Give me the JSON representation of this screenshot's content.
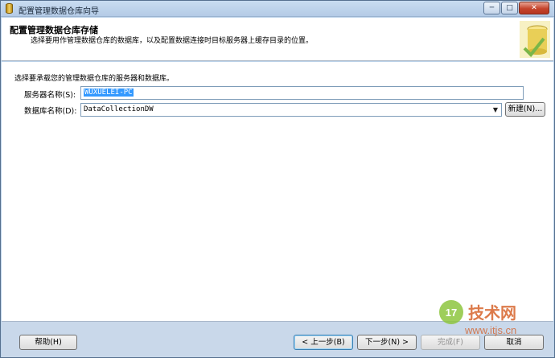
{
  "window": {
    "title": "配置管理数据仓库向导",
    "min_glyph": "─",
    "max_glyph": "□",
    "close_glyph": "✕"
  },
  "header": {
    "title": "配置管理数据仓库存储",
    "subtitle": "选择要用作管理数据仓库的数据库，以及配置数据连接时目标服务器上缓存目录的位置。"
  },
  "main": {
    "instruction": "选择要承载您的管理数据仓库的服务器和数据库。",
    "server_label": "服务器名称(S):",
    "server_value": "WUXUELEI-PC",
    "db_label": "数据库名称(D):",
    "db_value": "DataCollectionDW",
    "new_button": "新建(N)..."
  },
  "footer": {
    "help": "帮助(H)",
    "back": "< 上一步(B)",
    "next": "下一步(N) >",
    "finish": "完成(F)",
    "cancel": "取消"
  },
  "watermark": {
    "badge": "17",
    "brand": "技术网",
    "url": "www.itjs.cn"
  }
}
